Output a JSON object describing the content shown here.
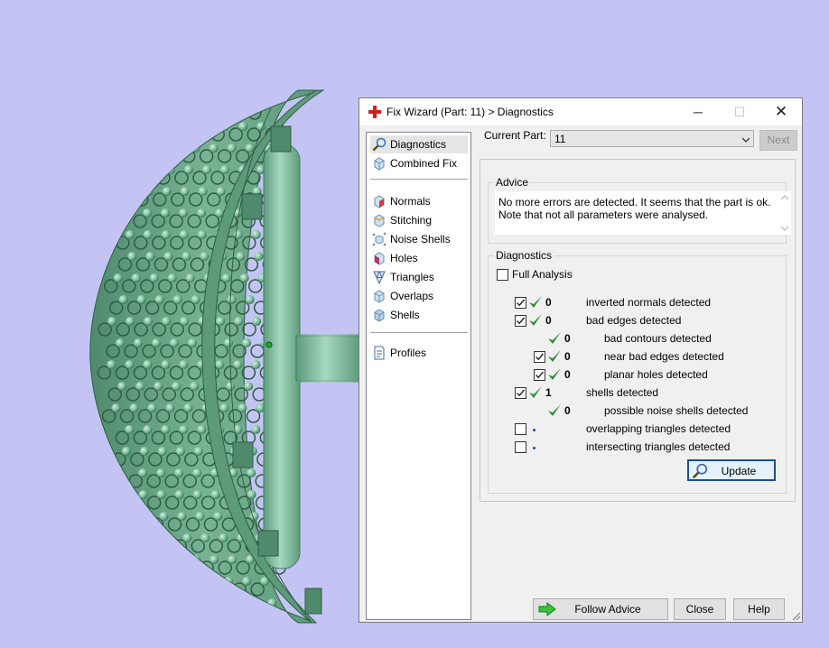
{
  "dialog": {
    "title": "Fix Wizard (Part: 11) > Diagnostics",
    "controls": {
      "minimize": "─",
      "maximize": "☐",
      "close": "✕"
    }
  },
  "nav": {
    "items": [
      {
        "label": "Diagnostics",
        "icon": "magnifier-icon",
        "selected": true
      },
      {
        "label": "Combined Fix",
        "icon": "cube-icon"
      },
      {
        "label": "Normals",
        "icon": "normals-cube-icon"
      },
      {
        "label": "Stitching",
        "icon": "stitching-cube-icon"
      },
      {
        "label": "Noise Shells",
        "icon": "noise-shells-icon"
      },
      {
        "label": "Holes",
        "icon": "holes-cube-icon"
      },
      {
        "label": "Triangles",
        "icon": "triangles-icon"
      },
      {
        "label": "Overlaps",
        "icon": "overlaps-cube-icon"
      },
      {
        "label": "Shells",
        "icon": "shells-cube-icon"
      },
      {
        "label": "Profiles",
        "icon": "profile-document-icon"
      }
    ]
  },
  "part": {
    "label": "Current Part:",
    "value": "11",
    "next_label": "Next"
  },
  "advice": {
    "title": "Advice",
    "lines": [
      "No more errors are detected. It seems that the part is ok.",
      "Note that not all parameters were analysed."
    ]
  },
  "diagnostics": {
    "title": "Diagnostics",
    "full_analysis_label": "Full Analysis",
    "rows": [
      {
        "count": "0",
        "text": "inverted normals detected",
        "checkbox": true,
        "checked": true,
        "status": "ok"
      },
      {
        "count": "0",
        "text": "bad edges detected",
        "checkbox": true,
        "checked": true,
        "status": "ok"
      },
      {
        "count": "0",
        "text": "bad contours detected",
        "checkbox": false,
        "status": "ok"
      },
      {
        "count": "0",
        "text": "near bad edges detected",
        "checkbox": true,
        "checked": true,
        "status": "ok"
      },
      {
        "count": "0",
        "text": "planar holes detected",
        "checkbox": true,
        "checked": true,
        "status": "ok"
      },
      {
        "count": "1",
        "text": "shells detected",
        "checkbox": true,
        "checked": true,
        "status": "ok"
      },
      {
        "count": "0",
        "text": "possible noise shells detected",
        "checkbox": false,
        "status": "ok"
      },
      {
        "count": "",
        "text": "overlapping triangles detected",
        "checkbox": true,
        "checked": false,
        "status": "not-run"
      },
      {
        "count": "",
        "text": "intersecting triangles detected",
        "checkbox": true,
        "checked": false,
        "status": "not-run"
      }
    ],
    "update_label": "Update"
  },
  "buttons": {
    "follow_advice": "Follow Advice",
    "close": "Close",
    "help": "Help"
  },
  "colors": {
    "background": "#c4c4f4",
    "model": "#6aa88a",
    "check": "#2e8b3a",
    "accent": "#1f4e8c"
  }
}
